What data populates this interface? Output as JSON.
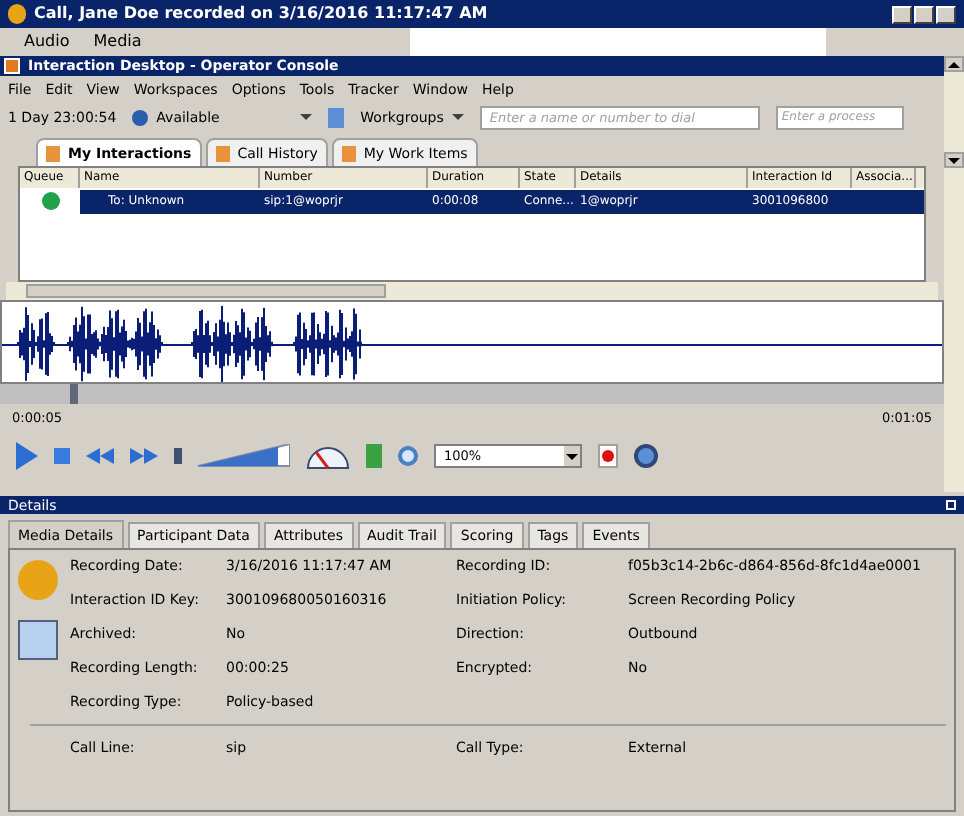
{
  "window": {
    "title": "Call, Jane Doe recorded on 3/16/2016 11:17:47 AM"
  },
  "outer_menu": [
    "Audio",
    "Media"
  ],
  "app": {
    "title": "Interaction Desktop - Operator Console"
  },
  "menu": [
    "File",
    "Edit",
    "View",
    "Workspaces",
    "Options",
    "Tools",
    "Tracker",
    "Window",
    "Help"
  ],
  "toolbar": {
    "timer": "1 Day 23:00:54",
    "status": "Available",
    "workgroups": "Workgroups",
    "dial": {
      "placeholder": "Enter a name or number to dial"
    },
    "process": {
      "placeholder": "Enter a process"
    }
  },
  "tabs": [
    {
      "label": "My Interactions",
      "selected": true
    },
    {
      "label": "Call History",
      "selected": false
    },
    {
      "label": "My Work Items",
      "selected": false
    }
  ],
  "table": {
    "columns": [
      "Queue",
      "Name",
      "Number",
      "Duration",
      "State",
      "Details",
      "Interaction Id",
      "Associa..."
    ],
    "rows": [
      {
        "selected": true,
        "cells": [
          "",
          "To: Unknown",
          "sip:1@woprjr",
          "0:00:08",
          "Conne...",
          "1@woprjr",
          "3001096800"
        ]
      }
    ]
  },
  "player": {
    "position": {
      "level": 0.075
    },
    "start": "0:00:05",
    "end": "0:01:05",
    "volume": {
      "level": 0.87
    },
    "zoom": "100%"
  },
  "details": {
    "title": "Details",
    "tabs": [
      {
        "label": "Media Details",
        "selected": true
      },
      {
        "label": "Participant Data",
        "selected": false
      },
      {
        "label": "Attributes",
        "selected": false
      },
      {
        "label": "Audit Trail",
        "selected": false
      },
      {
        "label": "Scoring",
        "selected": false
      },
      {
        "label": "Tags",
        "selected": false
      },
      {
        "label": "Events",
        "selected": false
      }
    ],
    "fields": [
      {
        "label": "Recording Date:",
        "value": "3/16/2016 11:17:47 AM"
      },
      {
        "label": "Recording ID:",
        "value": "f05b3c14-2b6c-d864-856d-8fc1d4ae0001"
      },
      {
        "label": "Interaction ID Key:",
        "value": "300109680050160316"
      },
      {
        "label": "Initiation Policy:",
        "value": "Screen Recording Policy"
      },
      {
        "label": "Archived:",
        "value": "No"
      },
      {
        "label": "Direction:",
        "value": "Outbound"
      },
      {
        "label": "Recording Length:",
        "value": "00:00:25"
      },
      {
        "label": "Encrypted:",
        "value": "No"
      },
      {
        "label": "Recording Type:",
        "value": "Policy-based"
      }
    ],
    "call_fields": [
      {
        "label": "Call Line:",
        "value": "sip"
      },
      {
        "label": "Call Type:",
        "value": "External"
      }
    ]
  }
}
